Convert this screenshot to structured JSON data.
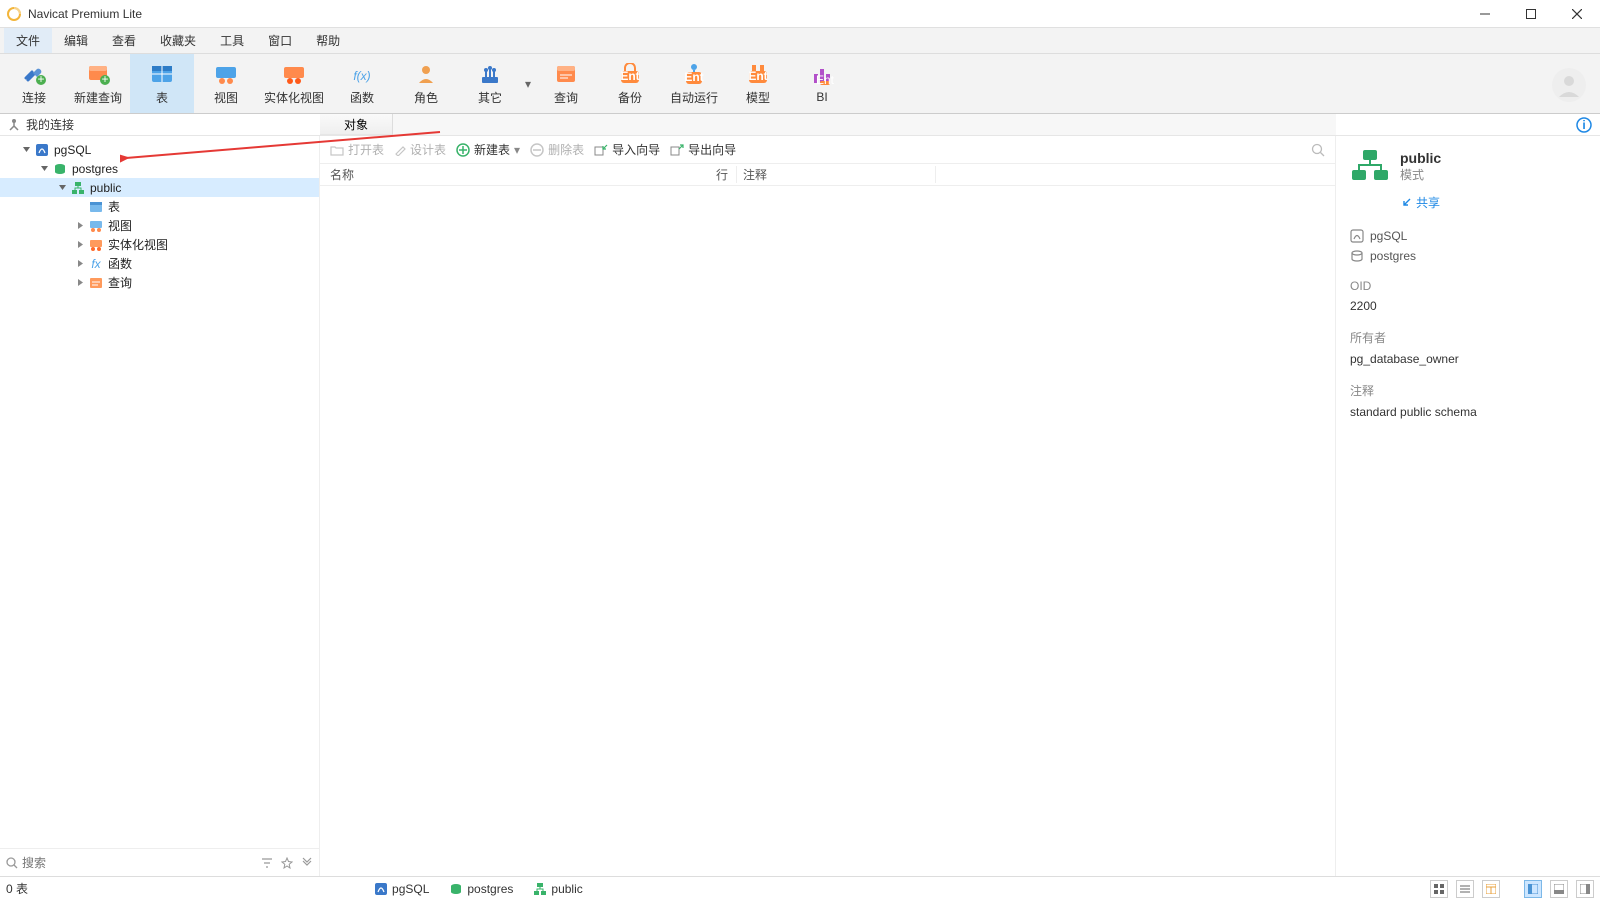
{
  "window": {
    "title": "Navicat Premium Lite"
  },
  "menu": {
    "items": [
      "文件",
      "编辑",
      "查看",
      "收藏夹",
      "工具",
      "窗口",
      "帮助"
    ],
    "selected": 0
  },
  "toolbar": {
    "buttons": [
      {
        "key": "connect",
        "label": "连接",
        "icon": "plug"
      },
      {
        "key": "newquery",
        "label": "新建查询",
        "icon": "newquery"
      },
      {
        "key": "tables",
        "label": "表",
        "icon": "tables",
        "selected": true
      },
      {
        "key": "views",
        "label": "视图",
        "icon": "views"
      },
      {
        "key": "matviews",
        "label": "实体化视图",
        "icon": "matviews",
        "wide": true
      },
      {
        "key": "functions",
        "label": "函数",
        "icon": "fx"
      },
      {
        "key": "roles",
        "label": "角色",
        "icon": "role"
      },
      {
        "key": "others",
        "label": "其它",
        "icon": "others",
        "chev": true
      },
      {
        "key": "queries",
        "label": "查询",
        "icon": "queries"
      },
      {
        "key": "backup",
        "label": "备份",
        "icon": "ent"
      },
      {
        "key": "automation",
        "label": "自动运行",
        "icon": "ent-robot"
      },
      {
        "key": "model",
        "label": "模型",
        "icon": "ent"
      },
      {
        "key": "bi",
        "label": "BI",
        "icon": "bi"
      }
    ]
  },
  "connections_header": {
    "label": "我的连接"
  },
  "tabs": {
    "items": [
      "对象"
    ],
    "active": 0
  },
  "tree": {
    "root": {
      "label": "pgSQL"
    },
    "db": {
      "label": "postgres"
    },
    "schema": {
      "label": "public"
    },
    "children": [
      {
        "key": "tables",
        "label": "表"
      },
      {
        "key": "views",
        "label": "视图",
        "expandable": true
      },
      {
        "key": "matviews",
        "label": "实体化视图",
        "expandable": true
      },
      {
        "key": "functions",
        "label": "函数",
        "expandable": true
      },
      {
        "key": "queries",
        "label": "查询",
        "expandable": true
      }
    ]
  },
  "side_search": {
    "placeholder": "搜索"
  },
  "obj_toolbar": {
    "open": "打开表",
    "design": "设计表",
    "create": "新建表",
    "delete": "删除表",
    "import": "导入向导",
    "export": "导出向导"
  },
  "obj_header": {
    "name": "名称",
    "rows": "行",
    "comment": "注释"
  },
  "info": {
    "title": "public",
    "subtitle": "模式",
    "share": "共享",
    "connection": "pgSQL",
    "database": "postgres",
    "oid_label": "OID",
    "oid_value": "2200",
    "owner_label": "所有者",
    "owner_value": "pg_database_owner",
    "comment_label": "注释",
    "comment_value": "standard public schema"
  },
  "statusbar": {
    "left": "0 表",
    "path": [
      {
        "icon": "pg",
        "label": "pgSQL"
      },
      {
        "icon": "db",
        "label": "postgres"
      },
      {
        "icon": "schema",
        "label": "public"
      }
    ]
  }
}
